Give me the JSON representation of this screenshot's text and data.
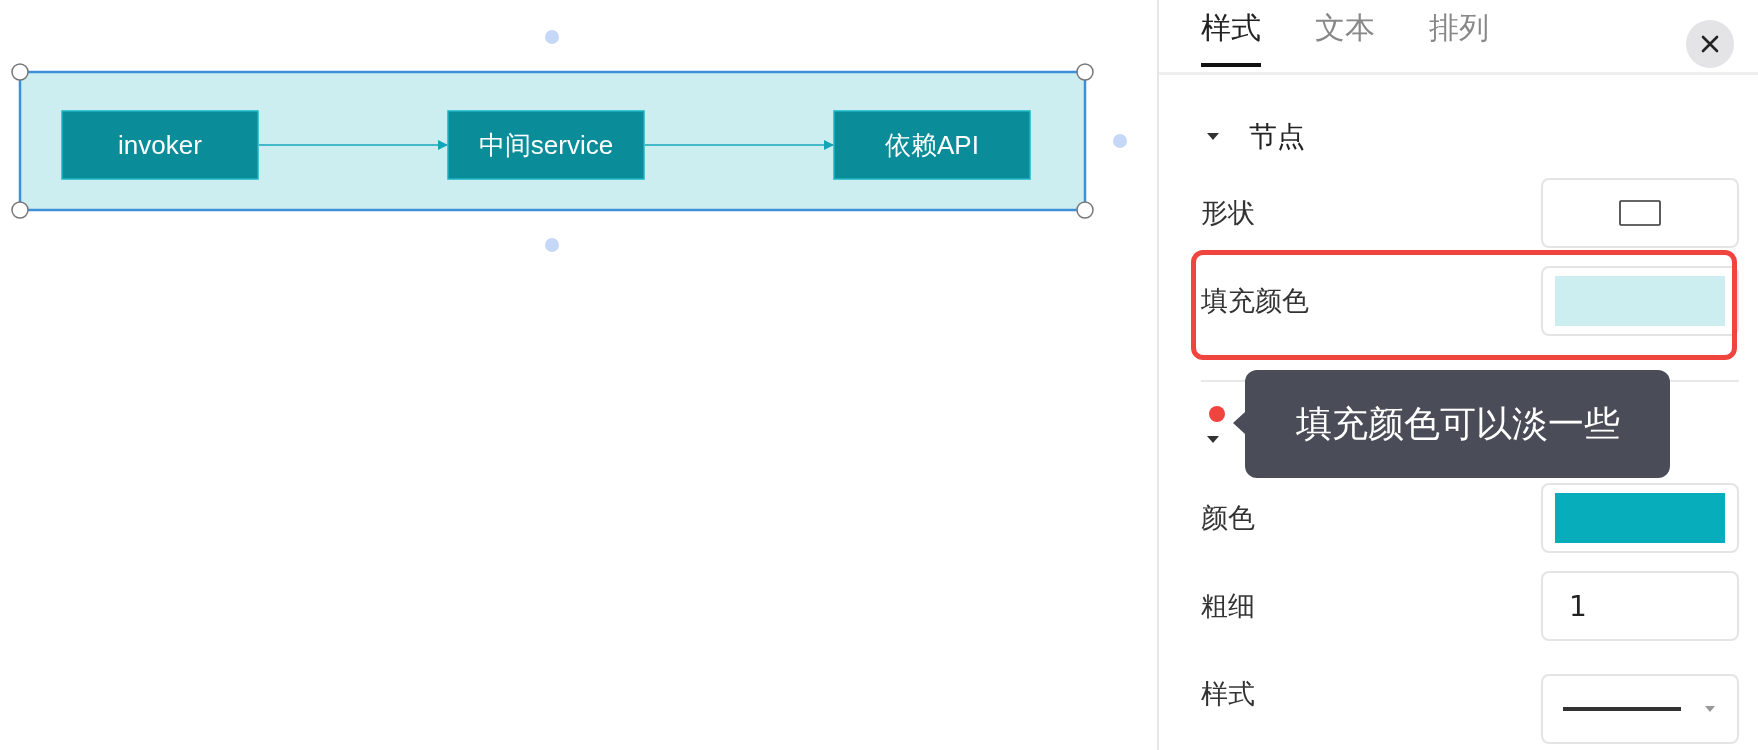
{
  "diagram": {
    "container": {
      "selected": true
    },
    "nodes": [
      {
        "label": "invoker"
      },
      {
        "label": "中间service"
      },
      {
        "label": "依赖API"
      }
    ]
  },
  "panel": {
    "tabs": [
      {
        "label": "样式",
        "selected": true
      },
      {
        "label": "文本",
        "selected": false
      },
      {
        "label": "排列",
        "selected": false
      }
    ],
    "sections": [
      {
        "title": "节点",
        "expanded": true,
        "rows": [
          {
            "kind": "shape",
            "label": "形状"
          },
          {
            "kind": "color",
            "label": "填充颜色",
            "color": "#cdeef0"
          }
        ]
      },
      {
        "expanded": true,
        "rows": [
          {
            "kind": "color",
            "label": "颜色",
            "color": "#08adbb"
          },
          {
            "kind": "number",
            "label": "粗细",
            "value": "1"
          },
          {
            "kind": "linestyle",
            "label": "样式"
          }
        ]
      }
    ]
  },
  "annotation": {
    "text": "填充颜色可以淡一些",
    "color": "#f0443f"
  }
}
